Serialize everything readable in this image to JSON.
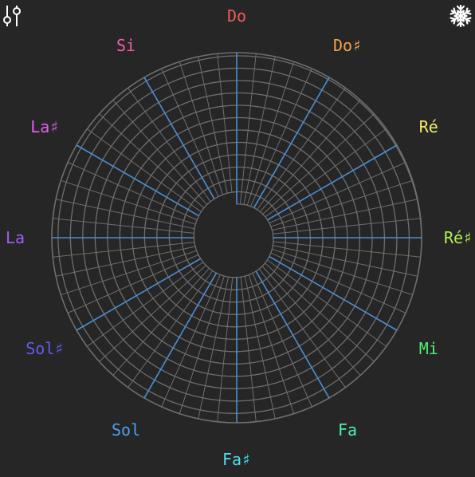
{
  "toolbar": {
    "settings_icon": "sliders-icon",
    "freeze_icon": "snowflake-icon"
  },
  "notes": [
    {
      "label": "Do",
      "color": "#f05a5a"
    },
    {
      "label": "Do♯",
      "color": "#f4a04e"
    },
    {
      "label": "Ré",
      "color": "#f2ec66"
    },
    {
      "label": "Ré♯",
      "color": "#aef04e"
    },
    {
      "label": "Mi",
      "color": "#4ef06e"
    },
    {
      "label": "Fa",
      "color": "#4ef0ae"
    },
    {
      "label": "Fa♯",
      "color": "#4eddf0"
    },
    {
      "label": "Sol",
      "color": "#4e9ef0"
    },
    {
      "label": "Sol♯",
      "color": "#5e5ef0"
    },
    {
      "label": "La",
      "color": "#a05ef0"
    },
    {
      "label": "La♯",
      "color": "#e05ef0"
    },
    {
      "label": "Si",
      "color": "#f05ea8"
    }
  ],
  "colors": {
    "background": "#262626",
    "grid": "#6e6e6e",
    "semitone_line": "#4a8fd0",
    "hub": "#262626",
    "icon": "#ffffff"
  }
}
